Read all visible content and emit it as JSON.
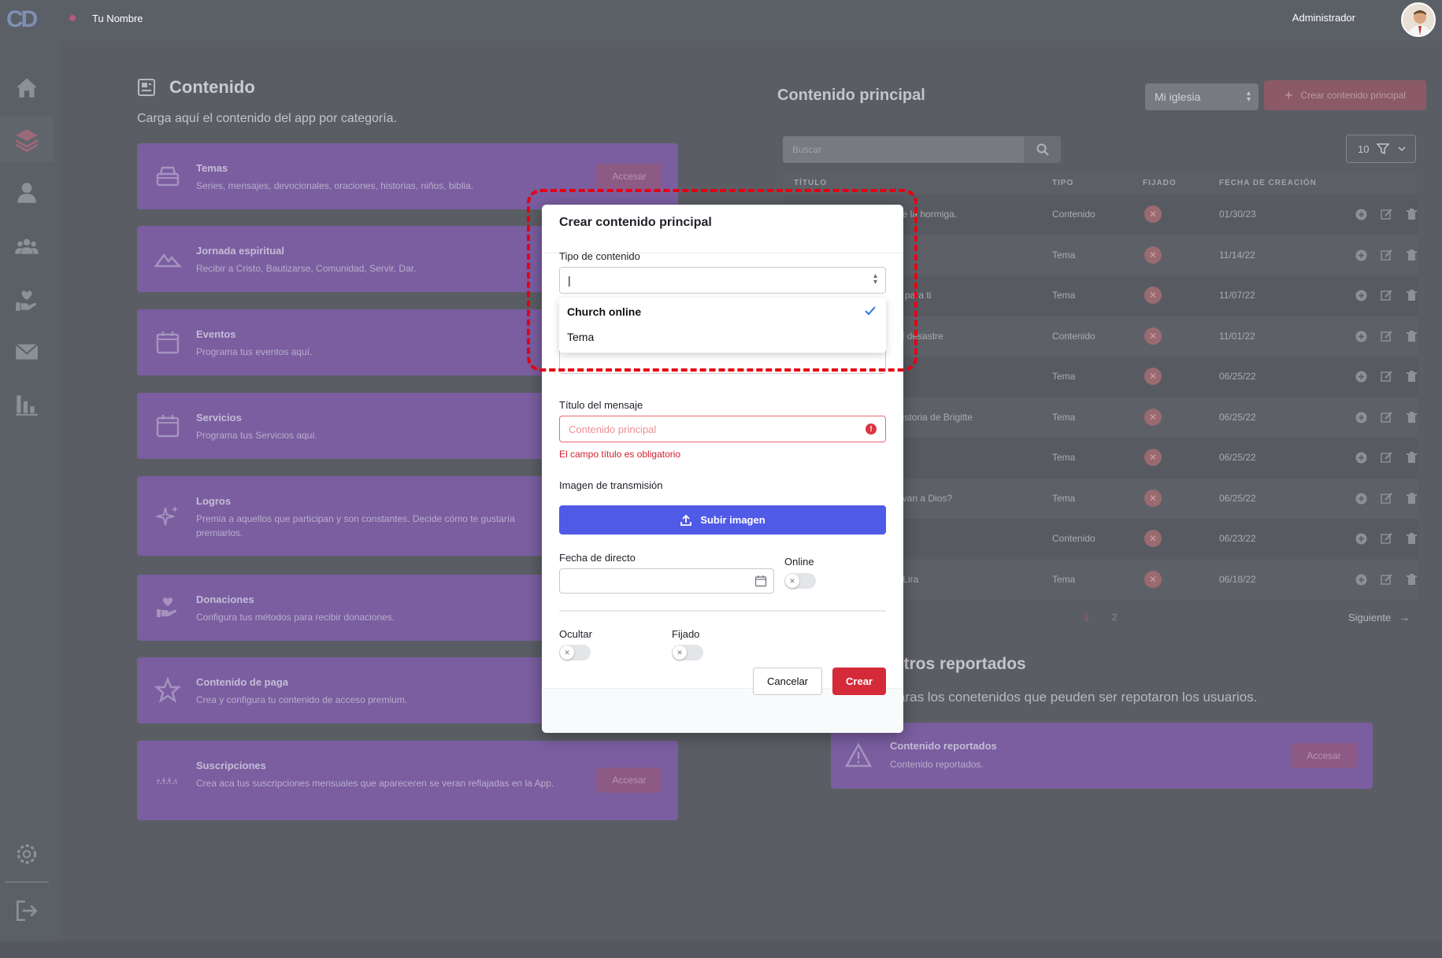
{
  "topbar": {
    "logo": "CD",
    "username": "Tu Nombre",
    "role": "Administrador"
  },
  "sidebar": {
    "items": [
      {
        "icon": "home-icon"
      },
      {
        "icon": "layers-icon",
        "active": true
      },
      {
        "icon": "user-icon"
      },
      {
        "icon": "group-icon"
      },
      {
        "icon": "heart-hand-icon"
      },
      {
        "icon": "mail-icon"
      },
      {
        "icon": "bar-chart-icon"
      }
    ],
    "bottom": [
      {
        "icon": "gear-icon"
      },
      {
        "icon": "logout-icon"
      }
    ]
  },
  "content": {
    "title": "Contenido",
    "subtitle": "Carga aquí el contenido del app por categoría.",
    "categories": [
      {
        "title": "Temas",
        "desc": "Series, mensajes, devocionales, oraciones, historias, niños, biblia.",
        "button": "Accesar"
      },
      {
        "title": "Jornada espiritual",
        "desc": "Recibir a Cristo, Bautizarse, Comunidad, Servir, Dar."
      },
      {
        "title": "Eventos",
        "desc": "Programa tus eventos aquí."
      },
      {
        "title": "Servicios",
        "desc": "Programa tus Servicios aquí."
      },
      {
        "title": "Logros",
        "desc": "Premia a aquellos que participan y son constantes. Decide cómo te gustaría premiarlos."
      },
      {
        "title": "Donaciones",
        "desc": "Configura tus métodos para recibir donaciones."
      },
      {
        "title": "Contenido de paga",
        "desc": "Crea y configura tu contenido de acceso premium."
      },
      {
        "title": "Suscripciones",
        "desc": "Crea aca tus suscripciones mensuales que apareceren se veran reflajadas en la App.",
        "button": "Accesar"
      }
    ]
  },
  "main_content": {
    "title": "Contenido principal",
    "church_select": "Mi iglesia",
    "create_button": "Crear contenido principal",
    "search_placeholder": "Buscar",
    "page_size": "10",
    "columns": {
      "title": "TÍTULO",
      "type": "TIPO",
      "pinned": "FIJADO",
      "created": "FECHA DE CREACIÓN"
    },
    "rows": [
      {
        "title": "de la hormiga.",
        "type": "Contenido",
        "date": "01/30/23"
      },
      {
        "title": "",
        "type": "Tema",
        "date": "11/14/22"
      },
      {
        "title": "n para ti",
        "type": "Tema",
        "date": "11/07/22"
      },
      {
        "title": "el desastre",
        "type": "Contenido",
        "date": "11/01/22"
      },
      {
        "title": "",
        "type": "Tema",
        "date": "06/25/22"
      },
      {
        "title": "historia de Brigitte",
        "type": "Tema",
        "date": "06/25/22"
      },
      {
        "title": "",
        "type": "Tema",
        "date": "06/25/22"
      },
      {
        "title": "evan a Dios?",
        "type": "Tema",
        "date": "06/25/22"
      },
      {
        "title": "",
        "type": "Contenido",
        "date": "06/23/22"
      },
      {
        "title": "r Lira",
        "type": "Tema",
        "date": "06/18/22"
      }
    ],
    "pagination": {
      "pages": [
        "1",
        "2"
      ],
      "next": "Siguiente"
    }
  },
  "reported": {
    "title": "istros reportados",
    "subtitle": "aras los conetenidos que peuden ser repotaron los usuarios.",
    "card": {
      "title": "Contenido reportados",
      "desc": "Contenido reportados.",
      "button": "Accesar"
    }
  },
  "modal": {
    "title": "Crear contenido principal",
    "content_type_label": "Tipo de contenido",
    "content_type_value": "|",
    "options": [
      {
        "label": "Church online",
        "selected": true
      },
      {
        "label": "Tema",
        "selected": false
      }
    ],
    "message_title_label": "Título del mensaje",
    "message_title_placeholder": "Contenido principal",
    "message_title_error": "El campo título es obligatorio",
    "image_label": "Imagen de transmisión",
    "upload_button": "Subir imagen",
    "date_label": "Fecha de directo",
    "online_label": "Online",
    "hide_label": "Ocultar",
    "pinned_label": "Fijado",
    "cancel_button": "Cancelar",
    "create_button": "Crear"
  },
  "colors": {
    "accent": "#4f5ae6",
    "danger": "#d42a3a",
    "card": "#7a5ea0",
    "highlight": "#e60012"
  }
}
